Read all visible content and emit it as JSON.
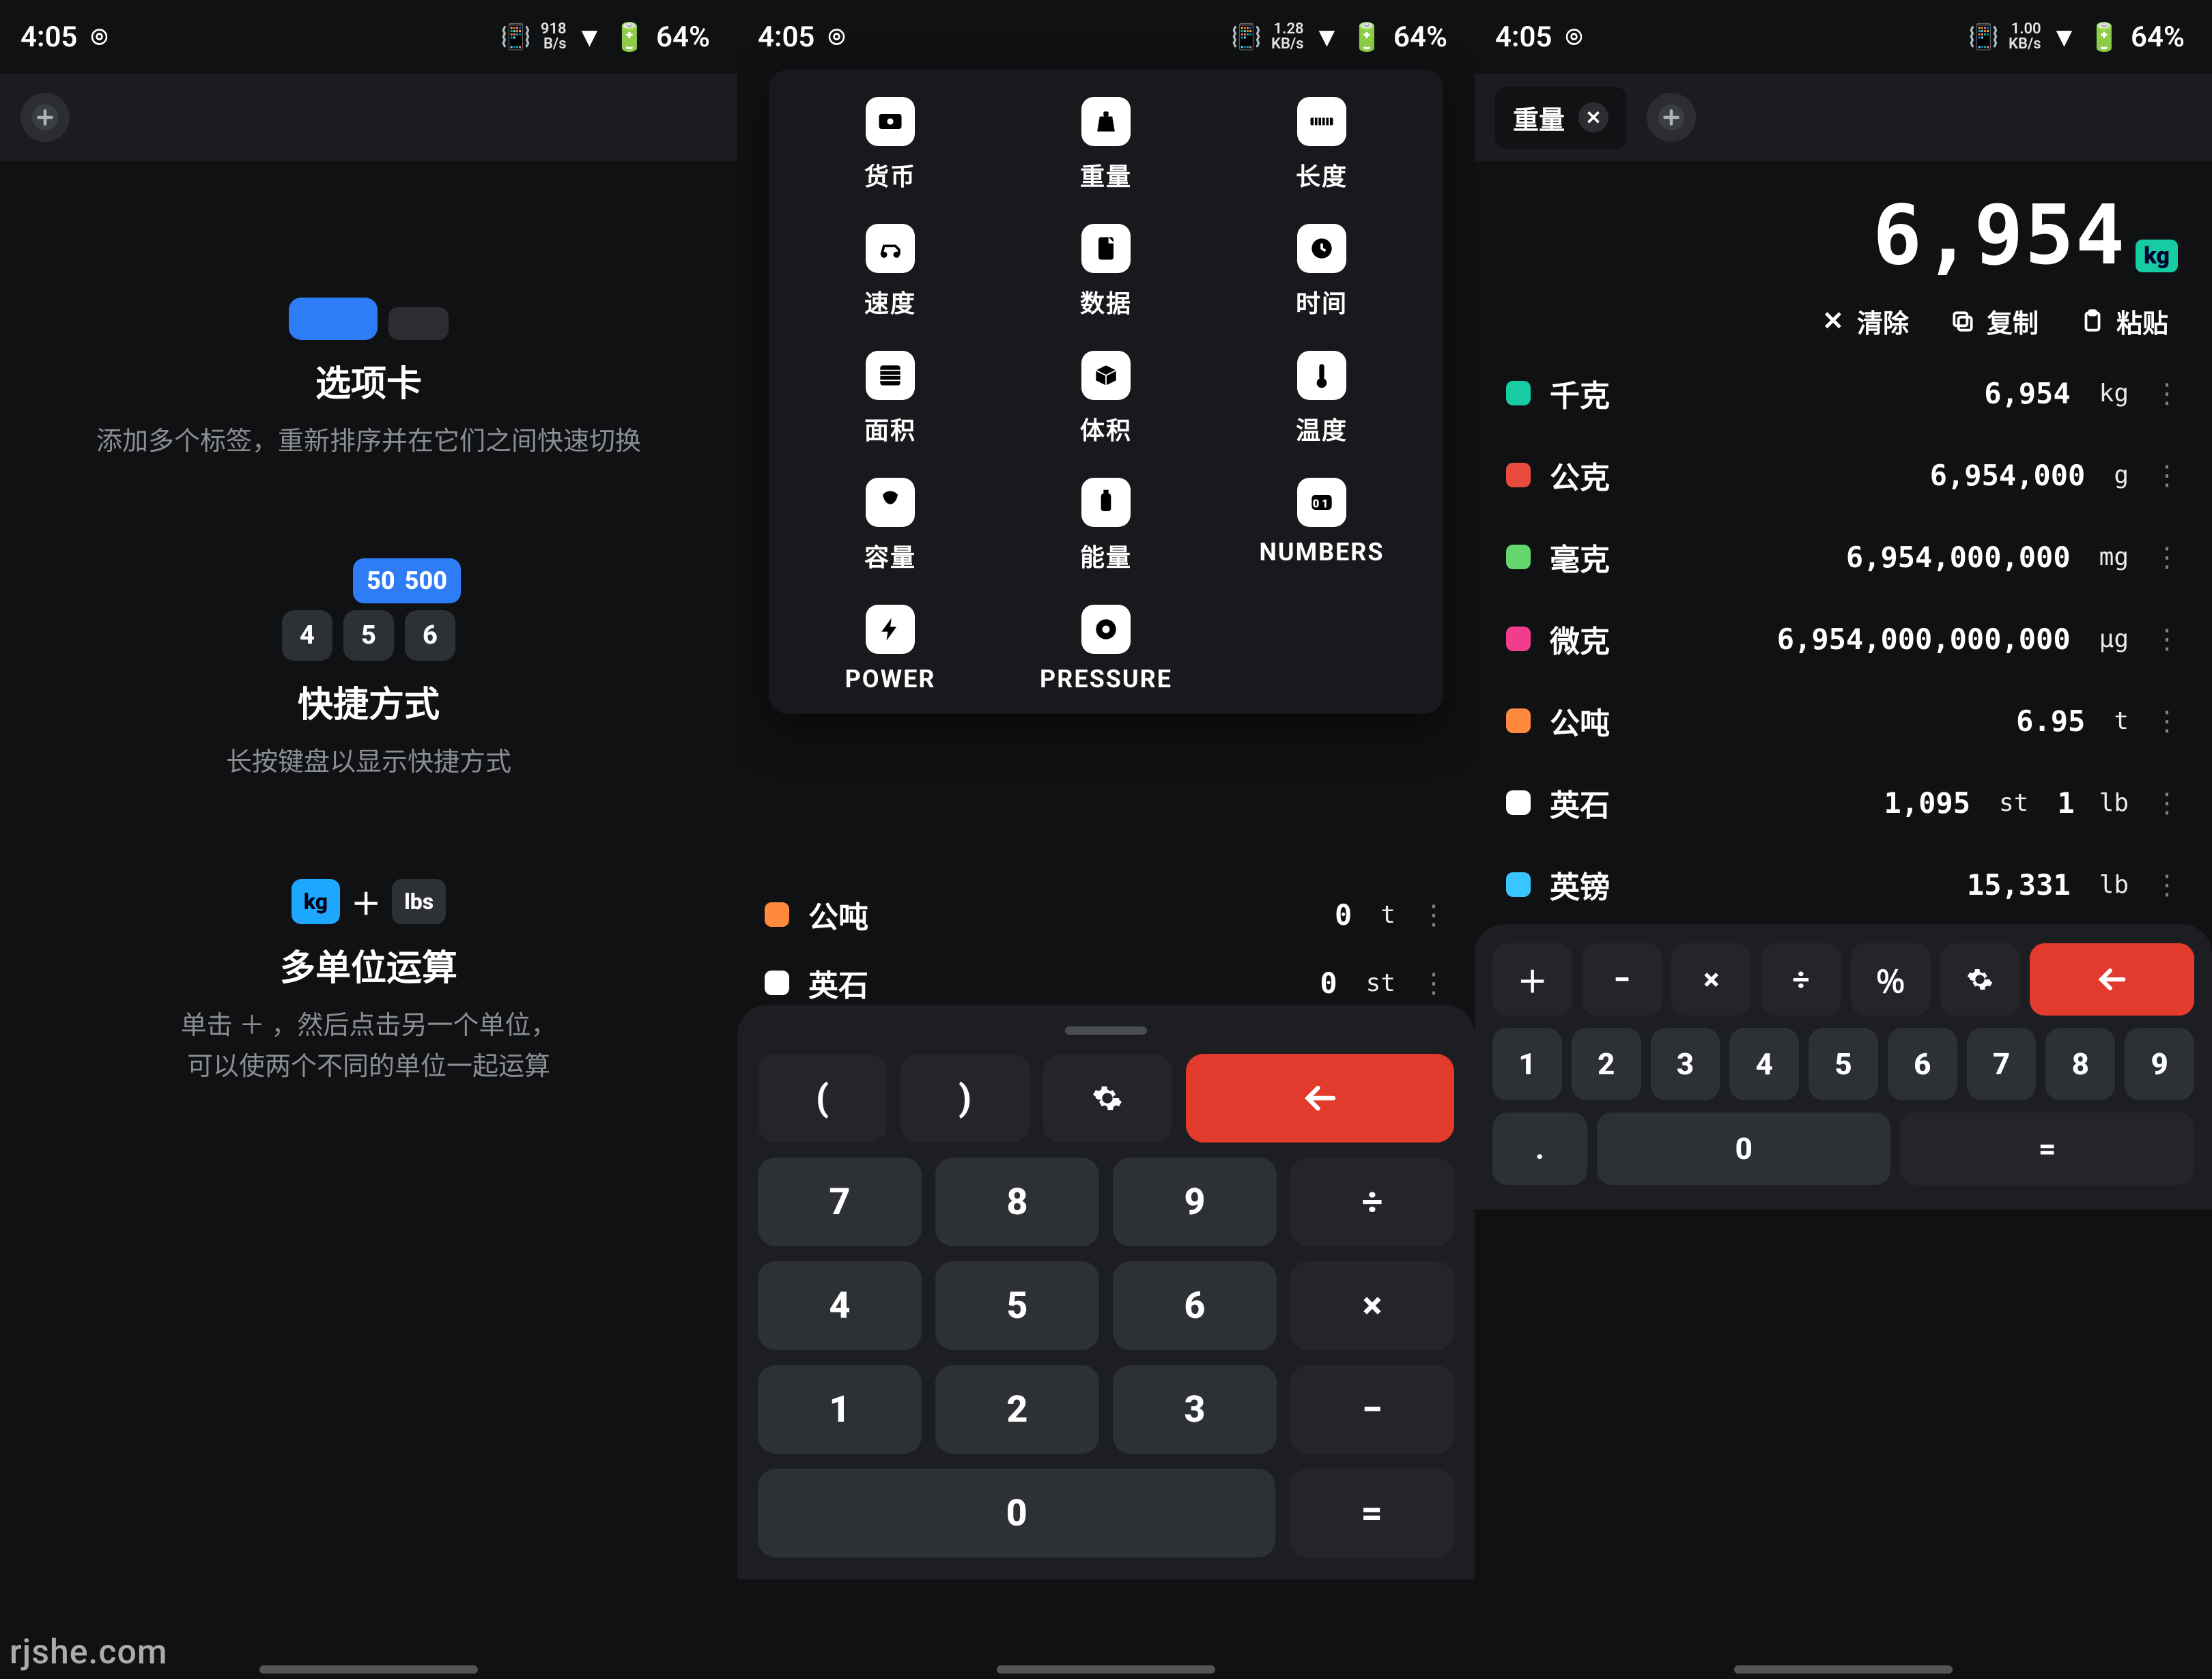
{
  "status": {
    "time": "4:05",
    "net": [
      {
        "top": "918",
        "bot": "B/s"
      },
      {
        "top": "1.28",
        "bot": "KB/s"
      },
      {
        "top": "1.00",
        "bot": "KB/s"
      }
    ],
    "battery_pct": "64%"
  },
  "tabstrip": {
    "tab_label": "重量"
  },
  "screen1": {
    "features": [
      {
        "title": "选项卡",
        "desc": "添加多个标签，重新排序并在它们之间快速切换"
      },
      {
        "title": "快捷方式",
        "desc": "长按键盘以显示快捷方式",
        "pill_a": "50",
        "pill_b": "500",
        "keys": [
          "4",
          "5",
          "6"
        ]
      },
      {
        "title": "多单位运算",
        "desc1": "单击 ＋ ，然后点击另一个单位，",
        "desc2": "可以使两个不同的单位一起运算",
        "badge_a": "kg",
        "badge_b": "lbs",
        "plus": "＋"
      }
    ]
  },
  "screen2": {
    "categories": [
      {
        "label": "货币",
        "icon": "currency"
      },
      {
        "label": "重量",
        "icon": "weight"
      },
      {
        "label": "长度",
        "icon": "length"
      },
      {
        "label": "速度",
        "icon": "speed"
      },
      {
        "label": "数据",
        "icon": "data"
      },
      {
        "label": "时间",
        "icon": "time"
      },
      {
        "label": "面积",
        "icon": "area"
      },
      {
        "label": "体积",
        "icon": "volume"
      },
      {
        "label": "温度",
        "icon": "temp"
      },
      {
        "label": "容量",
        "icon": "capacity"
      },
      {
        "label": "能量",
        "icon": "energy"
      },
      {
        "label": "NUMBERS",
        "icon": "numbers"
      },
      {
        "label": "POWER",
        "icon": "power"
      },
      {
        "label": "PRESSURE",
        "icon": "pressure"
      }
    ],
    "peek": [
      {
        "name": "公吨",
        "value": "0",
        "unit": "t",
        "color": "var(--accent-orange)"
      },
      {
        "name": "英石",
        "value": "0",
        "unit": "st",
        "color": "#ffffff"
      }
    ],
    "keypad": {
      "row1": [
        "(",
        ")",
        "gear",
        "back"
      ],
      "row2": [
        "7",
        "8",
        "9",
        "÷"
      ],
      "row3": [
        "4",
        "5",
        "6",
        "×"
      ],
      "row4": [
        "1",
        "2",
        "3",
        "−"
      ],
      "row5": [
        "0",
        "="
      ]
    }
  },
  "screen3": {
    "display_value": "6,954",
    "display_unit": "kg",
    "actions": {
      "clear": "清除",
      "copy": "复制",
      "paste": "粘贴"
    },
    "units": [
      {
        "name": "千克",
        "value": "6,954",
        "unit": "kg",
        "color": "var(--accent-teal)"
      },
      {
        "name": "公克",
        "value": "6,954,000",
        "unit": "g",
        "color": "var(--accent-red)"
      },
      {
        "name": "毫克",
        "value": "6,954,000,000",
        "unit": "mg",
        "color": "var(--accent-green)"
      },
      {
        "name": "微克",
        "value": "6,954,000,000,000",
        "unit": "µg",
        "color": "var(--accent-pink)"
      },
      {
        "name": "公吨",
        "value": "6.95",
        "unit": "t",
        "color": "var(--accent-orange)"
      },
      {
        "name": "英石",
        "value": "1,095",
        "unit": "st",
        "value2": "1",
        "unit2": "lb",
        "color": "#ffffff"
      },
      {
        "name": "英镑",
        "value": "15,331",
        "unit": "lb",
        "color": "var(--accent-cyan)"
      }
    ],
    "keypad": {
      "ops": [
        "＋",
        "−",
        "×",
        "÷",
        "％",
        "gear",
        "back"
      ],
      "nums": [
        "1",
        "2",
        "3",
        "4",
        "5",
        "6",
        "7",
        "8",
        "9"
      ],
      "bottom": [
        ".",
        "0",
        "="
      ]
    }
  },
  "watermark": "rjshe.com"
}
